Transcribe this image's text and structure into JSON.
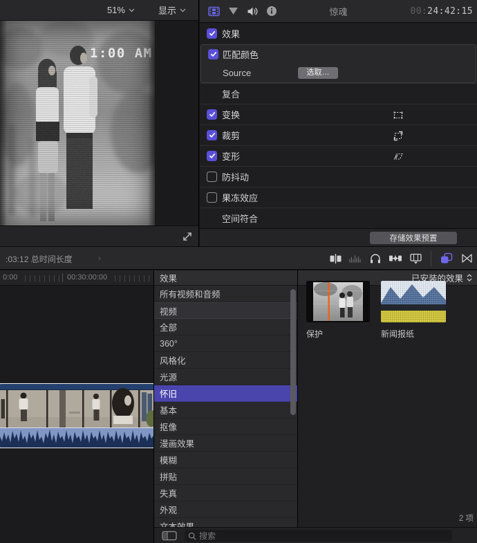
{
  "viewer": {
    "zoom_level": "51%",
    "display_menu": "显示",
    "overlay_time": "1:00 AM"
  },
  "inspector": {
    "title": "惊魂",
    "timecode_prefix": "00:",
    "timecode": "24:42:15",
    "rows": [
      {
        "label": "效果",
        "checked": true
      },
      {
        "label": "匹配颜色",
        "checked": true
      },
      {
        "label": "Source"
      },
      {
        "label": "复合"
      },
      {
        "label": "变换",
        "checked": true
      },
      {
        "label": "裁剪",
        "checked": true
      },
      {
        "label": "变形",
        "checked": true
      },
      {
        "label": "防抖动",
        "checked": false
      },
      {
        "label": "果冻效应",
        "checked": false
      },
      {
        "label": "空间符合"
      }
    ],
    "choose_button": "选取…",
    "save_preset_button": "存储效果预置"
  },
  "toolbar": {
    "duration": ":03:12 总时间长度",
    "chevron": "›"
  },
  "timeline": {
    "ruler_start": "0:00",
    "ruler_mid": "00:30:00:00"
  },
  "effects_browser": {
    "panel_header": "效果",
    "categories": [
      {
        "label": "所有视频和音频"
      },
      {
        "label": "视频",
        "section": true
      },
      {
        "label": "全部"
      },
      {
        "label": "360°"
      },
      {
        "label": "风格化"
      },
      {
        "label": "光源"
      },
      {
        "label": "怀旧",
        "selected": true
      },
      {
        "label": "基本"
      },
      {
        "label": "抠像"
      },
      {
        "label": "漫画效果"
      },
      {
        "label": "模糊"
      },
      {
        "label": "拼贴"
      },
      {
        "label": "失真"
      },
      {
        "label": "外观"
      },
      {
        "label": "文本效果"
      }
    ],
    "installed_header": "已安装的效果",
    "effects": [
      {
        "name": "保护"
      },
      {
        "name": "新闻报纸"
      }
    ],
    "search_placeholder": "搜索",
    "item_count": "2 项"
  },
  "colors": {
    "accent": "#5a4fd8",
    "selection": "#4a45ad"
  }
}
